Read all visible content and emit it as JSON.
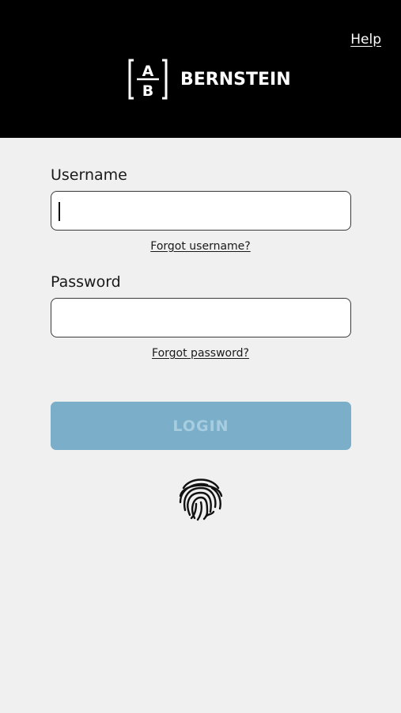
{
  "header": {
    "help_label": "Help",
    "logo_letter_top": "A",
    "logo_letter_bottom": "B",
    "brand_name": "BERNSTEIN"
  },
  "form": {
    "username_label": "Username",
    "username_value": "",
    "forgot_username": "Forgot username?",
    "password_label": "Password",
    "password_value": "",
    "forgot_password": "Forgot password?",
    "login_label": "LOGIN"
  },
  "icons": {
    "biometric": "fingerprint-icon"
  },
  "colors": {
    "header_bg": "#000000",
    "page_bg": "#f0f0f0",
    "login_button_bg": "#7aaec9",
    "login_button_text": "#a7cde0"
  }
}
